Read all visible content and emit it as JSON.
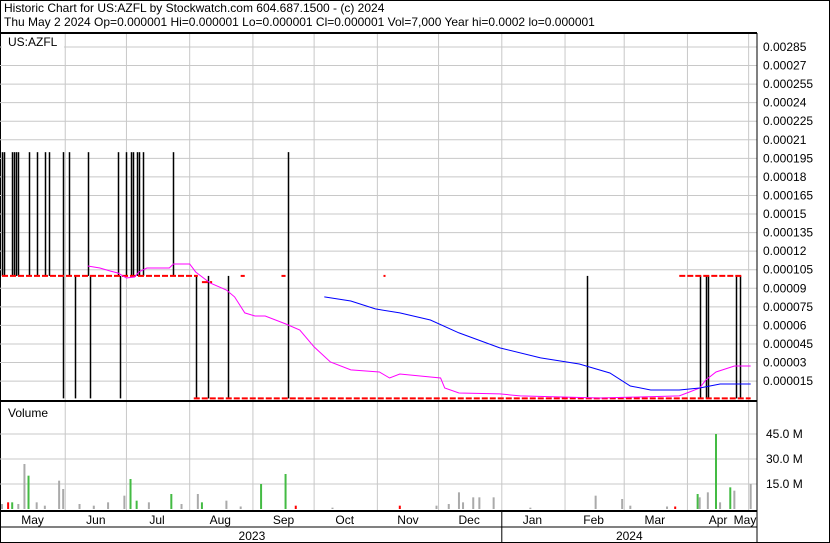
{
  "header": {
    "line1": "Historic Chart for US:AZFL by Stockwatch.com 604.687.1500 - (c) 2024",
    "line2": "Thu May  2 2024   Op=0.000001   Hi=0.000001   Lo=0.000001   Cl=0.000001   Vol=7,000   Year hi=0.0002   lo=0.000001"
  },
  "colors": {
    "ma_short": "#ff00ff",
    "ma_long": "#0000ff",
    "close": "#ff0000",
    "bar": "#000000",
    "vol_up": "#44bb44",
    "vol_down": "#ff0000",
    "vol_flat": "#aaaaaa",
    "grid": "#c8c8c8"
  },
  "chart_data": {
    "type": "line",
    "symbol_label": "US:AZFL",
    "start_date": "2023-05-01",
    "end_date": "2024-05-02",
    "price_axis": {
      "ylim": [
        0,
        0.0003
      ],
      "ticks": [
        "0.00285",
        "0.00027",
        "0.000255",
        "0.00024",
        "0.000225",
        "0.00021",
        "0.000195",
        "0.00018",
        "0.000165",
        "0.00015",
        "0.000135",
        "0.00012",
        "0.000105",
        "0.00009",
        "0.000075",
        "0.00006",
        "0.000045",
        "0.00003",
        "0.000015"
      ],
      "tick_values": [
        0.000285,
        0.00027,
        0.000255,
        0.00024,
        0.000225,
        0.00021,
        0.000195,
        0.00018,
        0.000165,
        0.00015,
        0.000135,
        0.00012,
        0.000105,
        9e-05,
        7.5e-05,
        6e-05,
        4.5e-05,
        3e-05,
        1.5e-05
      ]
    },
    "price_bars": [
      {
        "date": "2023-05-01",
        "high": 0.0002,
        "low": 0.0001
      },
      {
        "date": "2023-05-02",
        "high": 0.0002,
        "low": 0.0001
      },
      {
        "date": "2023-05-06",
        "high": 0.0002,
        "low": 0.0001
      },
      {
        "date": "2023-05-07",
        "high": 0.0002,
        "low": 0.0001
      },
      {
        "date": "2023-05-08",
        "high": 0.0002,
        "low": 0.0001
      },
      {
        "date": "2023-05-09",
        "high": 0.0002,
        "low": 0.0001
      },
      {
        "date": "2023-05-14",
        "high": 0.0002,
        "low": 0.0001
      },
      {
        "date": "2023-05-18",
        "high": 0.0002,
        "low": 0.0001
      },
      {
        "date": "2023-05-22",
        "high": 0.0002,
        "low": 0.0001
      },
      {
        "date": "2023-05-24",
        "high": 0.0002,
        "low": 0.0001
      },
      {
        "date": "2023-05-31",
        "high": 0.0002,
        "low": 1e-06
      },
      {
        "date": "2023-06-03",
        "high": 0.0002,
        "low": 0.0001
      },
      {
        "date": "2023-06-06",
        "high": 0.0001,
        "low": 1e-06
      },
      {
        "date": "2023-06-12",
        "high": 0.0002,
        "low": 0.0001
      },
      {
        "date": "2023-06-13",
        "high": 0.0001,
        "low": 1e-06
      },
      {
        "date": "2023-06-27",
        "high": 0.0002,
        "low": 0.0001
      },
      {
        "date": "2023-06-28",
        "high": 0.0001,
        "low": 1e-06
      },
      {
        "date": "2023-07-01",
        "high": 0.0002,
        "low": 0.0001
      },
      {
        "date": "2023-07-03",
        "high": 0.0002,
        "low": 0.0001
      },
      {
        "date": "2023-07-04",
        "high": 0.0002,
        "low": 0.0001
      },
      {
        "date": "2023-07-06",
        "high": 0.0002,
        "low": 0.0001
      },
      {
        "date": "2023-07-07",
        "high": 0.0002,
        "low": 0.0001
      },
      {
        "date": "2023-07-09",
        "high": 0.0002,
        "low": 0.0001
      },
      {
        "date": "2023-07-24",
        "high": 0.0002,
        "low": 0.0001
      },
      {
        "date": "2023-08-04",
        "high": 0.0001,
        "low": 1e-06
      },
      {
        "date": "2023-08-10",
        "high": 0.0001,
        "low": 1e-06
      },
      {
        "date": "2023-08-20",
        "high": 0.0001,
        "low": 1e-06
      },
      {
        "date": "2023-09-18",
        "high": 0.0002,
        "low": 1e-06
      },
      {
        "date": "2024-02-12",
        "high": 0.0001,
        "low": 1e-06
      },
      {
        "date": "2024-04-07",
        "high": 0.0001,
        "low": 1e-06
      },
      {
        "date": "2024-04-10",
        "high": 0.0001,
        "low": 1e-06
      },
      {
        "date": "2024-04-11",
        "high": 0.0001,
        "low": 1e-06
      },
      {
        "date": "2024-04-25",
        "high": 0.0001,
        "low": 1e-06
      },
      {
        "date": "2024-04-27",
        "high": 0.0001,
        "low": 1e-06
      }
    ],
    "close_runs": [
      {
        "from": "2023-05-01",
        "to": "2023-08-05",
        "value": 0.0001
      },
      {
        "from": "2023-08-07",
        "to": "2023-08-12",
        "value": 9.5e-05
      },
      {
        "from": "2023-08-26",
        "to": "2023-08-28",
        "value": 0.0001
      },
      {
        "from": "2023-09-15",
        "to": "2023-09-17",
        "value": 0.0001
      },
      {
        "from": "2023-11-04",
        "to": "2023-11-05",
        "value": 0.0001
      },
      {
        "from": "2024-03-28",
        "to": "2024-04-28",
        "value": 0.0001
      },
      {
        "from": "2023-08-03",
        "to": "2024-05-02",
        "value": 1e-06
      }
    ],
    "series": [
      {
        "name": "Short moving average",
        "color_key": "ma_short",
        "points": [
          [
            "2023-06-12",
            0.000108
          ],
          [
            "2023-06-18",
            0.0001064
          ],
          [
            "2023-06-23",
            0.000104
          ],
          [
            "2023-06-27",
            0.0001023
          ],
          [
            "2023-07-01",
            9.83e-05
          ],
          [
            "2023-07-05",
            9.91e-05
          ],
          [
            "2023-07-07",
            0.0001031
          ],
          [
            "2023-07-11",
            0.0001064
          ],
          [
            "2023-07-22",
            0.0001064
          ],
          [
            "2023-07-24",
            0.0001096
          ],
          [
            "2023-08-01",
            0.0001096
          ],
          [
            "2023-08-04",
            0.0001031
          ],
          [
            "2023-08-11",
            9.43e-05
          ],
          [
            "2023-08-19",
            8.86e-05
          ],
          [
            "2023-08-23",
            8.3e-05
          ],
          [
            "2023-08-28",
            7.01e-05
          ],
          [
            "2023-09-02",
            6.76e-05
          ],
          [
            "2023-09-07",
            6.76e-05
          ],
          [
            "2023-09-17",
            6.12e-05
          ],
          [
            "2023-09-24",
            5.63e-05
          ],
          [
            "2023-10-01",
            4.26e-05
          ],
          [
            "2023-10-09",
            3.04e-05
          ],
          [
            "2023-10-19",
            2.4e-05
          ],
          [
            "2023-11-02",
            2.23e-05
          ],
          [
            "2023-11-07",
            1.75e-05
          ],
          [
            "2023-11-12",
            2.07e-05
          ],
          [
            "2023-12-02",
            1.75e-05
          ],
          [
            "2023-12-04",
            9.4e-06
          ],
          [
            "2023-12-11",
            5.4e-06
          ],
          [
            "2023-12-31",
            4.6e-06
          ],
          [
            "2024-01-10",
            3e-06
          ],
          [
            "2024-02-18",
            1.3e-06
          ],
          [
            "2024-03-28",
            3e-06
          ],
          [
            "2024-04-02",
            6.2e-06
          ],
          [
            "2024-04-07",
            9.4e-06
          ],
          [
            "2024-04-10",
            1.59e-05
          ],
          [
            "2024-04-15",
            2.23e-05
          ],
          [
            "2024-04-24",
            2.72e-05
          ],
          [
            "2024-05-02",
            2.72e-05
          ]
        ]
      },
      {
        "name": "Long moving average",
        "color_key": "ma_long",
        "points": [
          [
            "2023-10-06",
            8.3e-05
          ],
          [
            "2023-10-19",
            7.97e-05
          ],
          [
            "2023-10-31",
            7.33e-05
          ],
          [
            "2023-11-12",
            7.01e-05
          ],
          [
            "2023-11-27",
            6.44e-05
          ],
          [
            "2023-12-11",
            5.39e-05
          ],
          [
            "2023-12-31",
            4.18e-05
          ],
          [
            "2024-01-20",
            3.37e-05
          ],
          [
            "2024-02-08",
            2.88e-05
          ],
          [
            "2024-02-23",
            2.15e-05
          ],
          [
            "2024-03-04",
            1.1e-05
          ],
          [
            "2024-03-14",
            7.8e-06
          ],
          [
            "2024-03-28",
            7.8e-06
          ],
          [
            "2024-04-07",
            9.4e-06
          ],
          [
            "2024-04-17",
            1.26e-05
          ],
          [
            "2024-05-02",
            1.26e-05
          ]
        ]
      }
    ],
    "volume": {
      "label": "Volume",
      "ylim": [
        0,
        55000000
      ],
      "ticks": [
        "45.0 M",
        "30.0 M",
        "15.0 M"
      ],
      "tick_values": [
        45000000,
        30000000,
        15000000
      ],
      "bars": [
        [
          "2023-05-01",
          3000000,
          "flat"
        ],
        [
          "2023-05-04",
          4000000,
          "down"
        ],
        [
          "2023-05-06",
          4000000,
          "up"
        ],
        [
          "2023-05-09",
          3000000,
          "flat"
        ],
        [
          "2023-05-12",
          27000000,
          "flat"
        ],
        [
          "2023-05-14",
          20000000,
          "up"
        ],
        [
          "2023-05-18",
          4000000,
          "flat"
        ],
        [
          "2023-05-22",
          2000000,
          "flat"
        ],
        [
          "2023-05-29",
          17000000,
          "flat"
        ],
        [
          "2023-05-31",
          12000000,
          "flat"
        ],
        [
          "2023-06-08",
          3000000,
          "flat"
        ],
        [
          "2023-06-15",
          2000000,
          "flat"
        ],
        [
          "2023-06-22",
          4000000,
          "flat"
        ],
        [
          "2023-06-30",
          8000000,
          "flat"
        ],
        [
          "2023-07-03",
          18000000,
          "up"
        ],
        [
          "2023-07-06",
          5000000,
          "up"
        ],
        [
          "2023-07-12",
          4000000,
          "flat"
        ],
        [
          "2023-07-23",
          9000000,
          "up"
        ],
        [
          "2023-07-28",
          3000000,
          "flat"
        ],
        [
          "2023-08-05",
          9000000,
          "flat"
        ],
        [
          "2023-08-07",
          4000000,
          "up"
        ],
        [
          "2023-08-19",
          5000000,
          "flat"
        ],
        [
          "2023-08-26",
          1500000,
          "flat"
        ],
        [
          "2023-09-05",
          15000000,
          "up"
        ],
        [
          "2023-09-17",
          21000000,
          "up"
        ],
        [
          "2023-09-22",
          2000000,
          "down"
        ],
        [
          "2023-10-10",
          800000,
          "flat"
        ],
        [
          "2023-11-12",
          2000000,
          "down"
        ],
        [
          "2023-11-30",
          2000000,
          "flat"
        ],
        [
          "2023-12-06",
          3000000,
          "flat"
        ],
        [
          "2023-12-11",
          10000000,
          "flat"
        ],
        [
          "2023-12-13",
          4000000,
          "flat"
        ],
        [
          "2023-12-18",
          7000000,
          "flat"
        ],
        [
          "2023-12-21",
          7000000,
          "flat"
        ],
        [
          "2023-12-28",
          7000000,
          "flat"
        ],
        [
          "2024-01-15",
          800000,
          "flat"
        ],
        [
          "2024-02-16",
          8000000,
          "flat"
        ],
        [
          "2024-02-29",
          6000000,
          "flat"
        ],
        [
          "2024-03-04",
          2000000,
          "flat"
        ],
        [
          "2024-03-22",
          1500000,
          "flat"
        ],
        [
          "2024-03-26",
          1500000,
          "down"
        ],
        [
          "2024-04-06",
          9000000,
          "up"
        ],
        [
          "2024-04-07",
          7000000,
          "flat"
        ],
        [
          "2024-04-11",
          10000000,
          "flat"
        ],
        [
          "2024-04-15",
          45000000,
          "up"
        ],
        [
          "2024-04-17",
          4000000,
          "flat"
        ],
        [
          "2024-04-22",
          13000000,
          "up"
        ],
        [
          "2024-04-24",
          11000000,
          "flat"
        ],
        [
          "2024-05-02",
          15000000,
          "flat"
        ]
      ]
    },
    "x_axis": {
      "months": [
        {
          "label": "May",
          "date": "2023-05-16"
        },
        {
          "label": "Jun",
          "date": "2023-06-16"
        },
        {
          "label": "Jul",
          "date": "2023-07-16"
        },
        {
          "label": "Aug",
          "date": "2023-08-16"
        },
        {
          "label": "Sep",
          "date": "2023-09-16"
        },
        {
          "label": "Oct",
          "date": "2023-10-16"
        },
        {
          "label": "Nov",
          "date": "2023-11-16"
        },
        {
          "label": "Dec",
          "date": "2023-12-16"
        },
        {
          "label": "Jan",
          "date": "2024-01-16"
        },
        {
          "label": "Feb",
          "date": "2024-02-15"
        },
        {
          "label": "Mar",
          "date": "2024-03-16"
        },
        {
          "label": "Apr",
          "date": "2024-04-16"
        },
        {
          "label": "May",
          "date": "2024-05-03"
        }
      ],
      "gridlines": [
        "2023-06-01",
        "2023-07-01",
        "2023-08-01",
        "2023-09-01",
        "2023-10-01",
        "2023-11-01",
        "2023-12-01",
        "2024-01-01",
        "2024-02-01",
        "2024-03-01",
        "2024-04-01",
        "2024-05-01"
      ],
      "years": [
        {
          "label": "2023",
          "from": "2023-05-01",
          "to": "2024-01-01"
        },
        {
          "label": "2024",
          "from": "2024-01-01",
          "to": "2024-05-05"
        }
      ]
    }
  }
}
